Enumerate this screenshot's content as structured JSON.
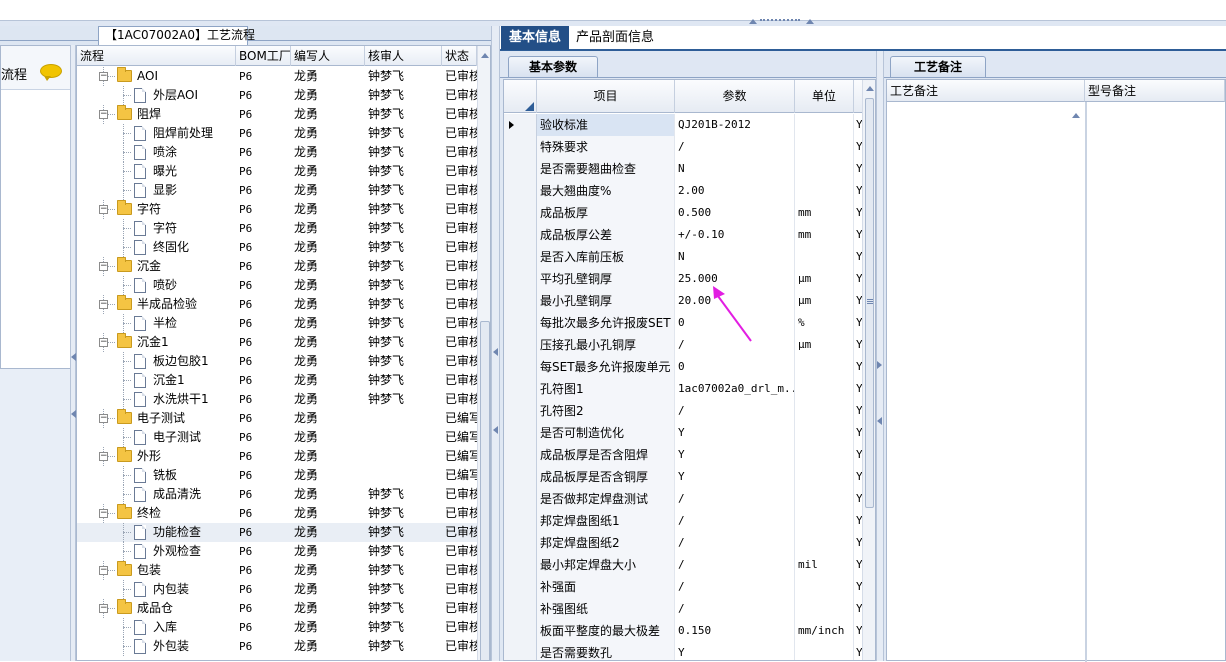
{
  "left": {
    "tab_label": "【1AC07002A0】工艺流程",
    "side_label": "流程",
    "columns": [
      "流程",
      "BOM工厂",
      "编写人",
      "核审人",
      "状态"
    ],
    "rows": [
      {
        "level": 1,
        "type": "folder",
        "name": "AOI",
        "bom": "P6",
        "writer": "龙勇",
        "reviewer": "钟梦飞",
        "status": "已审核"
      },
      {
        "level": 2,
        "type": "doc",
        "name": "外层AOI",
        "bom": "P6",
        "writer": "龙勇",
        "reviewer": "钟梦飞",
        "status": "已审核"
      },
      {
        "level": 1,
        "type": "folder",
        "name": "阻焊",
        "bom": "P6",
        "writer": "龙勇",
        "reviewer": "钟梦飞",
        "status": "已审核"
      },
      {
        "level": 2,
        "type": "doc",
        "name": "阻焊前处理",
        "bom": "P6",
        "writer": "龙勇",
        "reviewer": "钟梦飞",
        "status": "已审核"
      },
      {
        "level": 2,
        "type": "doc",
        "name": "喷涂",
        "bom": "P6",
        "writer": "龙勇",
        "reviewer": "钟梦飞",
        "status": "已审核"
      },
      {
        "level": 2,
        "type": "doc",
        "name": "曝光",
        "bom": "P6",
        "writer": "龙勇",
        "reviewer": "钟梦飞",
        "status": "已审核"
      },
      {
        "level": 2,
        "type": "doc",
        "name": "显影",
        "bom": "P6",
        "writer": "龙勇",
        "reviewer": "钟梦飞",
        "status": "已审核"
      },
      {
        "level": 1,
        "type": "folder",
        "name": "字符",
        "bom": "P6",
        "writer": "龙勇",
        "reviewer": "钟梦飞",
        "status": "已审核"
      },
      {
        "level": 2,
        "type": "doc",
        "name": "字符",
        "bom": "P6",
        "writer": "龙勇",
        "reviewer": "钟梦飞",
        "status": "已审核"
      },
      {
        "level": 2,
        "type": "doc",
        "name": "终固化",
        "bom": "P6",
        "writer": "龙勇",
        "reviewer": "钟梦飞",
        "status": "已审核"
      },
      {
        "level": 1,
        "type": "folder",
        "name": "沉金",
        "bom": "P6",
        "writer": "龙勇",
        "reviewer": "钟梦飞",
        "status": "已审核"
      },
      {
        "level": 2,
        "type": "doc",
        "name": "喷砂",
        "bom": "P6",
        "writer": "龙勇",
        "reviewer": "钟梦飞",
        "status": "已审核"
      },
      {
        "level": 1,
        "type": "folder",
        "name": "半成品检验",
        "bom": "P6",
        "writer": "龙勇",
        "reviewer": "钟梦飞",
        "status": "已审核"
      },
      {
        "level": 2,
        "type": "doc",
        "name": "半检",
        "bom": "P6",
        "writer": "龙勇",
        "reviewer": "钟梦飞",
        "status": "已审核"
      },
      {
        "level": 1,
        "type": "folder",
        "name": "沉金1",
        "bom": "P6",
        "writer": "龙勇",
        "reviewer": "钟梦飞",
        "status": "已审核"
      },
      {
        "level": 2,
        "type": "doc",
        "name": "板边包胶1",
        "bom": "P6",
        "writer": "龙勇",
        "reviewer": "钟梦飞",
        "status": "已审核"
      },
      {
        "level": 2,
        "type": "doc",
        "name": "沉金1",
        "bom": "P6",
        "writer": "龙勇",
        "reviewer": "钟梦飞",
        "status": "已审核"
      },
      {
        "level": 2,
        "type": "doc",
        "name": "水洗烘干1",
        "bom": "P6",
        "writer": "龙勇",
        "reviewer": "钟梦飞",
        "status": "已审核"
      },
      {
        "level": 1,
        "type": "folder",
        "name": "电子测试",
        "bom": "P6",
        "writer": "龙勇",
        "reviewer": "",
        "status": "已编写"
      },
      {
        "level": 2,
        "type": "doc",
        "name": "电子测试",
        "bom": "P6",
        "writer": "龙勇",
        "reviewer": "",
        "status": "已编写"
      },
      {
        "level": 1,
        "type": "folder",
        "name": "外形",
        "bom": "P6",
        "writer": "龙勇",
        "reviewer": "",
        "status": "已编写"
      },
      {
        "level": 2,
        "type": "doc",
        "name": "铣板",
        "bom": "P6",
        "writer": "龙勇",
        "reviewer": "",
        "status": "已编写"
      },
      {
        "level": 2,
        "type": "doc",
        "name": "成品清洗",
        "bom": "P6",
        "writer": "龙勇",
        "reviewer": "钟梦飞",
        "status": "已审核"
      },
      {
        "level": 1,
        "type": "folder",
        "name": "终检",
        "bom": "P6",
        "writer": "龙勇",
        "reviewer": "钟梦飞",
        "status": "已审核"
      },
      {
        "level": 2,
        "type": "doc",
        "name": "功能检查",
        "bom": "P6",
        "writer": "龙勇",
        "reviewer": "钟梦飞",
        "status": "已审核",
        "selected": true
      },
      {
        "level": 2,
        "type": "doc",
        "name": "外观检查",
        "bom": "P6",
        "writer": "龙勇",
        "reviewer": "钟梦飞",
        "status": "已审核"
      },
      {
        "level": 1,
        "type": "folder",
        "name": "包装",
        "bom": "P6",
        "writer": "龙勇",
        "reviewer": "钟梦飞",
        "status": "已审核"
      },
      {
        "level": 2,
        "type": "doc",
        "name": "内包装",
        "bom": "P6",
        "writer": "龙勇",
        "reviewer": "钟梦飞",
        "status": "已审核"
      },
      {
        "level": 1,
        "type": "folder",
        "name": "成品仓",
        "bom": "P6",
        "writer": "龙勇",
        "reviewer": "钟梦飞",
        "status": "已审核"
      },
      {
        "level": 2,
        "type": "doc",
        "name": "入库",
        "bom": "P6",
        "writer": "龙勇",
        "reviewer": "钟梦飞",
        "status": "已审核"
      },
      {
        "level": 2,
        "type": "doc",
        "name": "外包装",
        "bom": "P6",
        "writer": "龙勇",
        "reviewer": "钟梦飞",
        "status": "已审核"
      }
    ]
  },
  "tabs": {
    "basic_info": "基本信息",
    "profile_info": "产品剖面信息"
  },
  "mid": {
    "subtab": "基本参数",
    "columns": [
      "项目",
      "参数",
      "单位"
    ],
    "rows": [
      {
        "item": "验收标准",
        "value": "QJ201B-2012",
        "unit": "",
        "flag": "Y",
        "current": true
      },
      {
        "item": "特殊要求",
        "value": "/",
        "unit": "",
        "flag": "Y"
      },
      {
        "item": "是否需要翘曲检查",
        "value": "N",
        "unit": "",
        "flag": "Y"
      },
      {
        "item": "最大翘曲度%",
        "value": "2.00",
        "unit": "",
        "flag": "Y"
      },
      {
        "item": "成品板厚",
        "value": "0.500",
        "unit": "mm",
        "flag": "Y"
      },
      {
        "item": "成品板厚公差",
        "value": "+/-0.10",
        "unit": "mm",
        "flag": "Y"
      },
      {
        "item": "是否入库前压板",
        "value": "N",
        "unit": "",
        "flag": "Y"
      },
      {
        "item": "平均孔壁铜厚",
        "value": "25.000",
        "unit": "μm",
        "flag": "Y"
      },
      {
        "item": "最小孔壁铜厚",
        "value": "20.00",
        "unit": "μm",
        "flag": "Y"
      },
      {
        "item": "每批次最多允许报废SET",
        "value": "0",
        "unit": "%",
        "flag": "Y"
      },
      {
        "item": "压接孔最小孔铜厚",
        "value": "/",
        "unit": "μm",
        "flag": "Y"
      },
      {
        "item": "每SET最多允许报废单元",
        "value": "0",
        "unit": "",
        "flag": "Y"
      },
      {
        "item": "孔符图1",
        "value": "1ac07002a0_drl_m...",
        "unit": "",
        "flag": "Y"
      },
      {
        "item": "孔符图2",
        "value": "/",
        "unit": "",
        "flag": "Y"
      },
      {
        "item": "是否可制造优化",
        "value": "Y",
        "unit": "",
        "flag": "Y"
      },
      {
        "item": "成品板厚是否含阻焊",
        "value": "Y",
        "unit": "",
        "flag": "Y"
      },
      {
        "item": "成品板厚是否含铜厚",
        "value": "Y",
        "unit": "",
        "flag": "Y"
      },
      {
        "item": "是否做邦定焊盘测试",
        "value": "/",
        "unit": "",
        "flag": "Y"
      },
      {
        "item": "邦定焊盘图纸1",
        "value": "/",
        "unit": "",
        "flag": "Y"
      },
      {
        "item": "邦定焊盘图纸2",
        "value": "/",
        "unit": "",
        "flag": "Y"
      },
      {
        "item": "最小邦定焊盘大小",
        "value": "/",
        "unit": "mil",
        "flag": "Y"
      },
      {
        "item": "补强面",
        "value": "/",
        "unit": "",
        "flag": "Y"
      },
      {
        "item": "补强图纸",
        "value": "/",
        "unit": "",
        "flag": "Y"
      },
      {
        "item": "板面平整度的最大极差",
        "value": "0.150",
        "unit": "mm/inch",
        "flag": "Y"
      },
      {
        "item": "是否需要数孔",
        "value": "Y",
        "unit": "",
        "flag": "Y"
      }
    ]
  },
  "right": {
    "subtab": "工艺备注",
    "col_process_note": "工艺备注",
    "col_model_note": "型号备注"
  },
  "colors": {
    "tab_active": "#234f87",
    "annotation_arrow": "#e21ee2",
    "folder": "#f4c443"
  },
  "icons": [
    "folder-icon",
    "document-icon",
    "expand-collapse-icon",
    "chat-bubble-icon"
  ]
}
